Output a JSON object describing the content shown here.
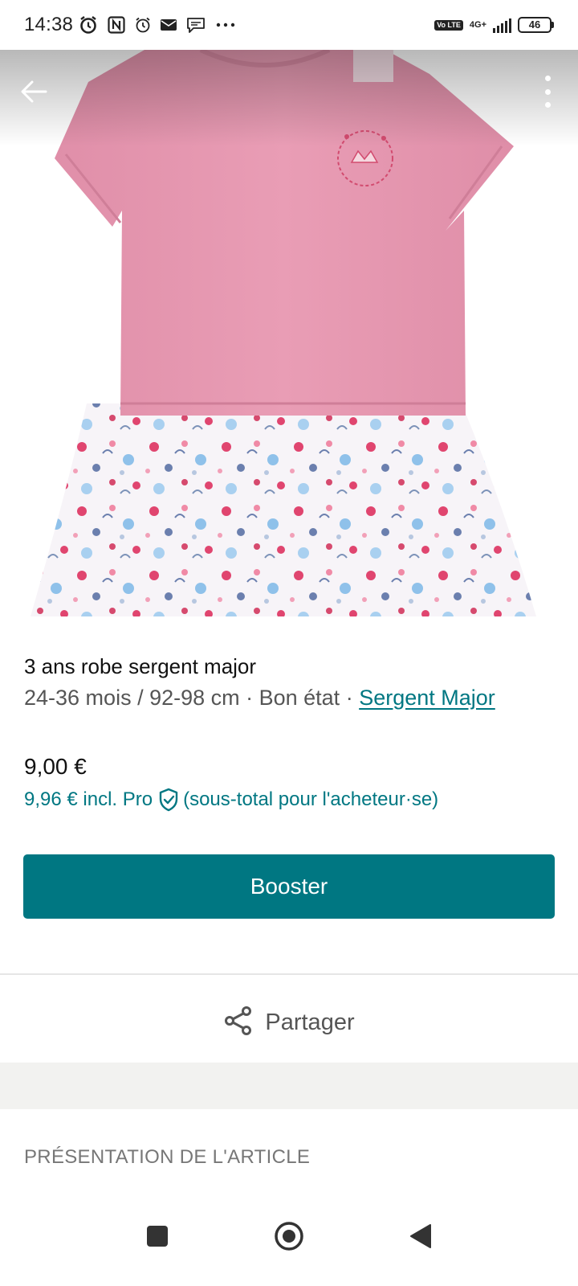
{
  "status_bar": {
    "time": "14:38",
    "network": "4G+",
    "volte": "Vo LTE",
    "battery": "46"
  },
  "header": {
    "back_icon": "arrow-left-icon",
    "more_icon": "more-vertical-icon"
  },
  "item": {
    "title": "3 ans robe sergent major",
    "meta": "24-36 mois / 92-98 cm · Bon état · ",
    "brand": "Sergent Major",
    "price": "9,00 €",
    "price_pro": "9,96 € incl. Pro",
    "price_pro_note": "(sous-total pour l'acheteur·se)"
  },
  "actions": {
    "booster_label": "Booster",
    "share_label": "Partager"
  },
  "section": {
    "title": "PRÉSENTATION DE L'ARTICLE"
  },
  "colors": {
    "accent": "#007782",
    "shirt": "#E79AB2",
    "background": "#FFFFFF"
  }
}
